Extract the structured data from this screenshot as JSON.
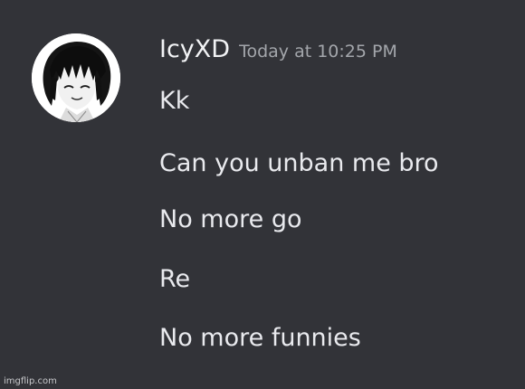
{
  "message": {
    "username": "IcyXD",
    "timestamp": "Today at 10:25 PM",
    "lines": [
      "Kk",
      "Can you unban me bro",
      "No more go",
      "Re",
      "No more funnies"
    ]
  },
  "avatar": {
    "icon": "user-avatar-anime-character"
  },
  "watermark": "imgflip.com",
  "colors": {
    "background": "#323338",
    "text": "#e9eaee",
    "timestamp": "#a3a6ab"
  }
}
